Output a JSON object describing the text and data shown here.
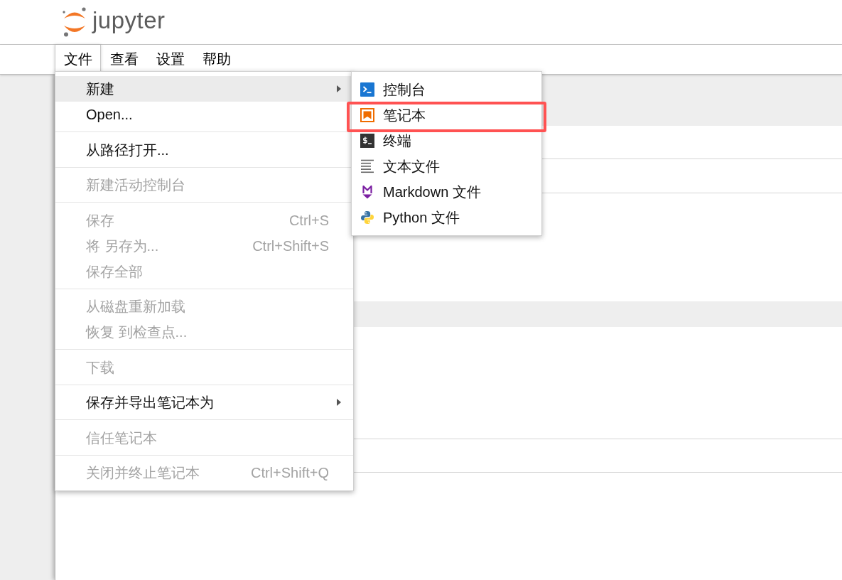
{
  "header": {
    "logo_text": "jupyter"
  },
  "menubar": [
    {
      "label": "文件",
      "selected": true
    },
    {
      "label": "查看",
      "selected": false
    },
    {
      "label": "设置",
      "selected": false
    },
    {
      "label": "帮助",
      "selected": false
    }
  ],
  "file_menu": {
    "sections": [
      {
        "items": [
          {
            "label": "新建",
            "disabled": false,
            "hovered": true,
            "has_submenu": true
          },
          {
            "label": "Open...",
            "disabled": false,
            "hovered": false,
            "has_submenu": false
          }
        ]
      },
      {
        "items": [
          {
            "label": "从路径打开...",
            "disabled": false,
            "hovered": false,
            "has_submenu": false
          }
        ]
      },
      {
        "items": [
          {
            "label": "新建活动控制台",
            "disabled": true,
            "hovered": false,
            "has_submenu": false
          }
        ]
      },
      {
        "items": [
          {
            "label": "保存",
            "shortcut": "Ctrl+S",
            "disabled": true,
            "hovered": false,
            "has_submenu": false
          },
          {
            "label": "将 另存为...",
            "shortcut": "Ctrl+Shift+S",
            "disabled": true,
            "hovered": false,
            "has_submenu": false
          },
          {
            "label": "保存全部",
            "disabled": true,
            "hovered": false,
            "has_submenu": false
          }
        ]
      },
      {
        "items": [
          {
            "label": "从磁盘重新加载",
            "disabled": true,
            "hovered": false,
            "has_submenu": false
          },
          {
            "label": "恢复 到检查点...",
            "disabled": true,
            "hovered": false,
            "has_submenu": false
          }
        ]
      },
      {
        "items": [
          {
            "label": "下载",
            "disabled": true,
            "hovered": false,
            "has_submenu": false
          }
        ]
      },
      {
        "items": [
          {
            "label": "保存并导出笔记本为",
            "disabled": false,
            "hovered": false,
            "has_submenu": true
          }
        ]
      },
      {
        "items": [
          {
            "label": "信任笔记本",
            "disabled": true,
            "hovered": false,
            "has_submenu": false
          }
        ]
      },
      {
        "items": [
          {
            "label": "关闭并终止笔记本",
            "shortcut": "Ctrl+Shift+Q",
            "disabled": true,
            "hovered": false,
            "has_submenu": false
          }
        ]
      }
    ]
  },
  "new_submenu": {
    "items": [
      {
        "kind": "console",
        "label": "控制台",
        "annotated": false
      },
      {
        "kind": "notebook",
        "label": "笔记本",
        "annotated": true
      },
      {
        "kind": "terminal",
        "label": "终端",
        "annotated": false
      },
      {
        "kind": "text",
        "label": "文本文件",
        "annotated": false
      },
      {
        "kind": "markdown",
        "label": "Markdown 文件",
        "annotated": false
      },
      {
        "kind": "python",
        "label": "Python 文件",
        "annotated": false
      }
    ]
  }
}
